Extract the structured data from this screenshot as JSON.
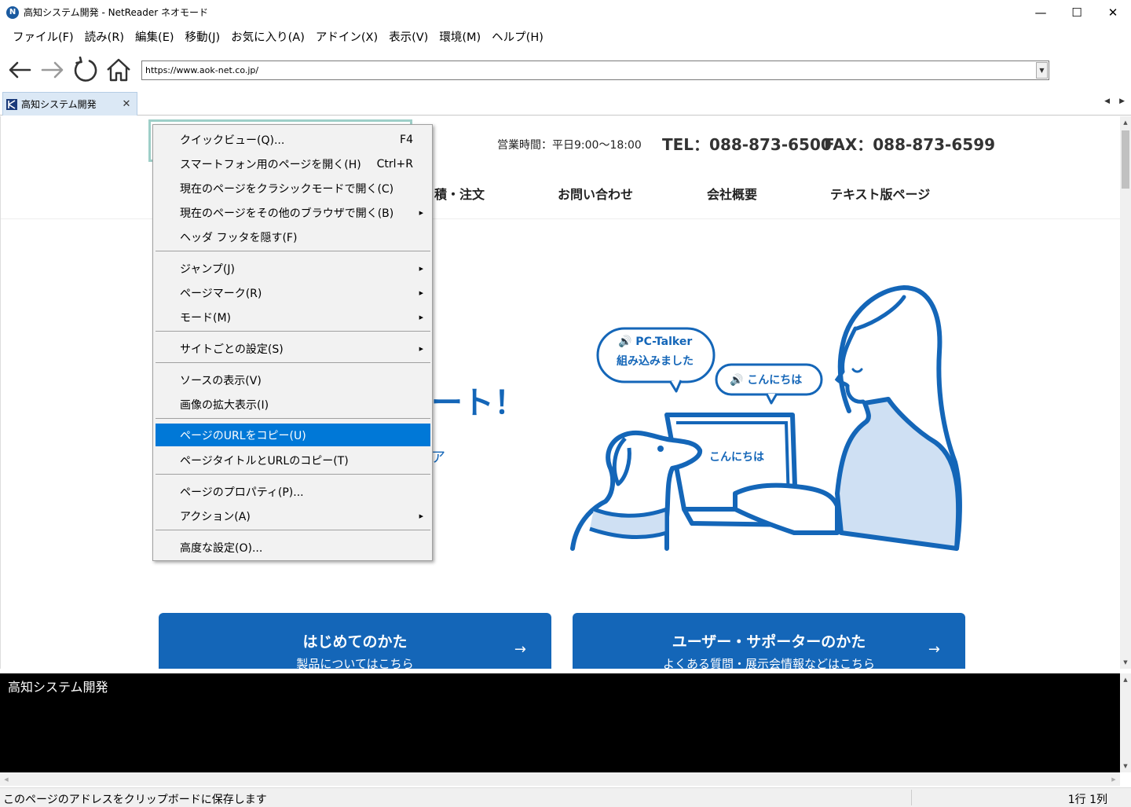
{
  "window": {
    "title": "高知システム開発 - NetReader ネオモード",
    "icon": "netreader-logo-icon",
    "minimize": "—",
    "maximize": "☐",
    "close": "✕"
  },
  "menubar": {
    "items": [
      "ファイル(F)",
      "読み(R)",
      "編集(E)",
      "移動(J)",
      "お気に入り(A)",
      "アドイン(X)",
      "表示(V)",
      "環境(M)",
      "ヘルプ(H)"
    ]
  },
  "toolbar": {
    "url": "https://www.aok-net.co.jp/",
    "dropdown_glyph": "▼"
  },
  "tab": {
    "label": "高知システム開発",
    "close": "✕",
    "prev": "◀",
    "next": "▶"
  },
  "page": {
    "hours": "営業時間：平日9:00～18:00",
    "tel": "TEL：088-873-6500",
    "fax": "FAX：088-873-6599",
    "nav": [
      "積・注文",
      "お問い合わせ",
      "会社概要",
      "テキスト版ページ"
    ],
    "hero": "ート！",
    "hero_small": "ア",
    "bubble1_line1": "🔊 PC-Talker",
    "bubble1_line2": "組み込みました",
    "bubble2": "🔊 こんにちは",
    "screen_text": "こんにちは",
    "card1_title": "はじめてのかた",
    "card1_sub": "製品についてはこちら",
    "card2_title": "ユーザー・サポーターのかた",
    "card2_sub": "よくある質問・展示会情報などはこちら",
    "arrow": "→"
  },
  "context_menu": {
    "items": [
      {
        "label": "クイックビュー(Q)...",
        "shortcut": "F4"
      },
      {
        "label": "スマートフォン用のページを開く(H)",
        "shortcut": "Ctrl+R"
      },
      {
        "label": "現在のページをクラシックモードで開く(C)"
      },
      {
        "label": "現在のページをその他のブラウザで開く(B)",
        "submenu": "▶"
      },
      {
        "label": "ヘッダ フッタを隠す(F)"
      },
      {
        "label": "ジャンプ(J)",
        "submenu": "▶"
      },
      {
        "label": "ページマーク(R)",
        "submenu": "▶"
      },
      {
        "label": "モード(M)",
        "submenu": "▶"
      },
      {
        "label": "サイトごとの設定(S)",
        "submenu": "▶"
      },
      {
        "label": "ソースの表示(V)"
      },
      {
        "label": "画像の拡大表示(I)"
      },
      {
        "label": "ページのURLをコピー(U)",
        "selected": true
      },
      {
        "label": "ページタイトルとURLのコピー(T)"
      },
      {
        "label": "ページのプロパティ(P)..."
      },
      {
        "label": "アクション(A)",
        "submenu": "▶"
      },
      {
        "label": "高度な設定(O)..."
      }
    ]
  },
  "text_pane": {
    "text": "高知システム開発"
  },
  "statusbar": {
    "message": "このページのアドレスをクリップボードに保存します",
    "position": "1行  1列"
  },
  "colors": {
    "accent": "#1466b8",
    "menu_highlight": "#0078d7",
    "logo_border": "#9ecfc8"
  }
}
